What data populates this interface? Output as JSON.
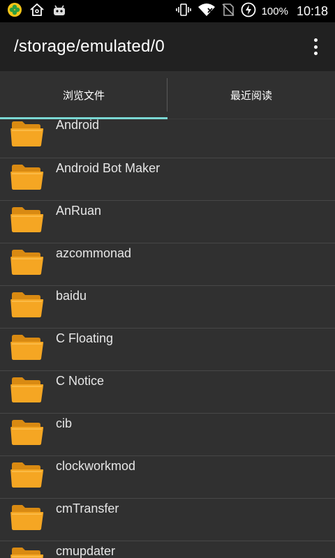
{
  "status_bar": {
    "left_icons": [
      "app-clover-icon",
      "home-outline-icon",
      "android-bot-icon"
    ],
    "right_icons": [
      "vibrate-icon",
      "wifi-icon",
      "no-sim-icon",
      "battery-charging-icon"
    ],
    "battery_text": "100%",
    "time": "10:18"
  },
  "toolbar": {
    "title": "/storage/emulated/0",
    "menu_icon": "more-vert-icon"
  },
  "tabs": [
    {
      "label": "浏览文件",
      "selected": true
    },
    {
      "label": "最近阅读",
      "selected": false
    }
  ],
  "files": [
    {
      "name": "Android"
    },
    {
      "name": "Android Bot Maker"
    },
    {
      "name": "AnRuan"
    },
    {
      "name": "azcommonad"
    },
    {
      "name": "baidu"
    },
    {
      "name": "C Floating"
    },
    {
      "name": "C Notice"
    },
    {
      "name": "cib"
    },
    {
      "name": "clockworkmod"
    },
    {
      "name": "cmTransfer"
    },
    {
      "name": "cmupdater"
    }
  ],
  "colors": {
    "accent": "#7ad7d3",
    "folder": "#f5a623",
    "background": "#303030",
    "toolbar": "#212121"
  }
}
